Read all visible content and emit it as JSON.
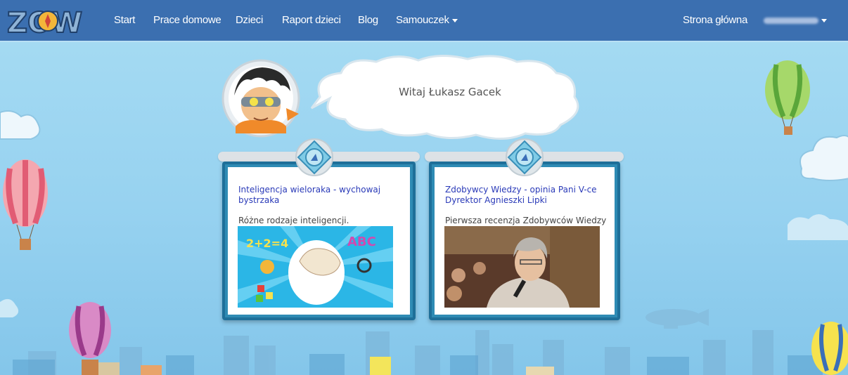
{
  "navbar": {
    "brand": "ZOW",
    "links": {
      "start": "Start",
      "homework": "Prace domowe",
      "children": "Dzieci",
      "report": "Raport dzieci",
      "blog": "Blog",
      "tutorial": "Samouczek"
    },
    "home": "Strona główna"
  },
  "greeting": "Witaj Łukasz Gacek",
  "cards": [
    {
      "title": "Inteligencja wieloraka - wychowaj bystrzaka",
      "description": "Różne rodzaje inteligencji.",
      "image_texts": [
        "2+2=4",
        "ABC"
      ]
    },
    {
      "title": "Zdobywcy Wiedzy - opinia Pani V-ce Dyrektor Agnieszki Lipki",
      "description": "Pierwsza recenzja Zdobywców Wiedzy"
    }
  ],
  "colors": {
    "navbar": "#3b6fb0",
    "link": "#2a3ab8",
    "card_frame": "#2e8bb4",
    "sky": "#97d2f0"
  }
}
